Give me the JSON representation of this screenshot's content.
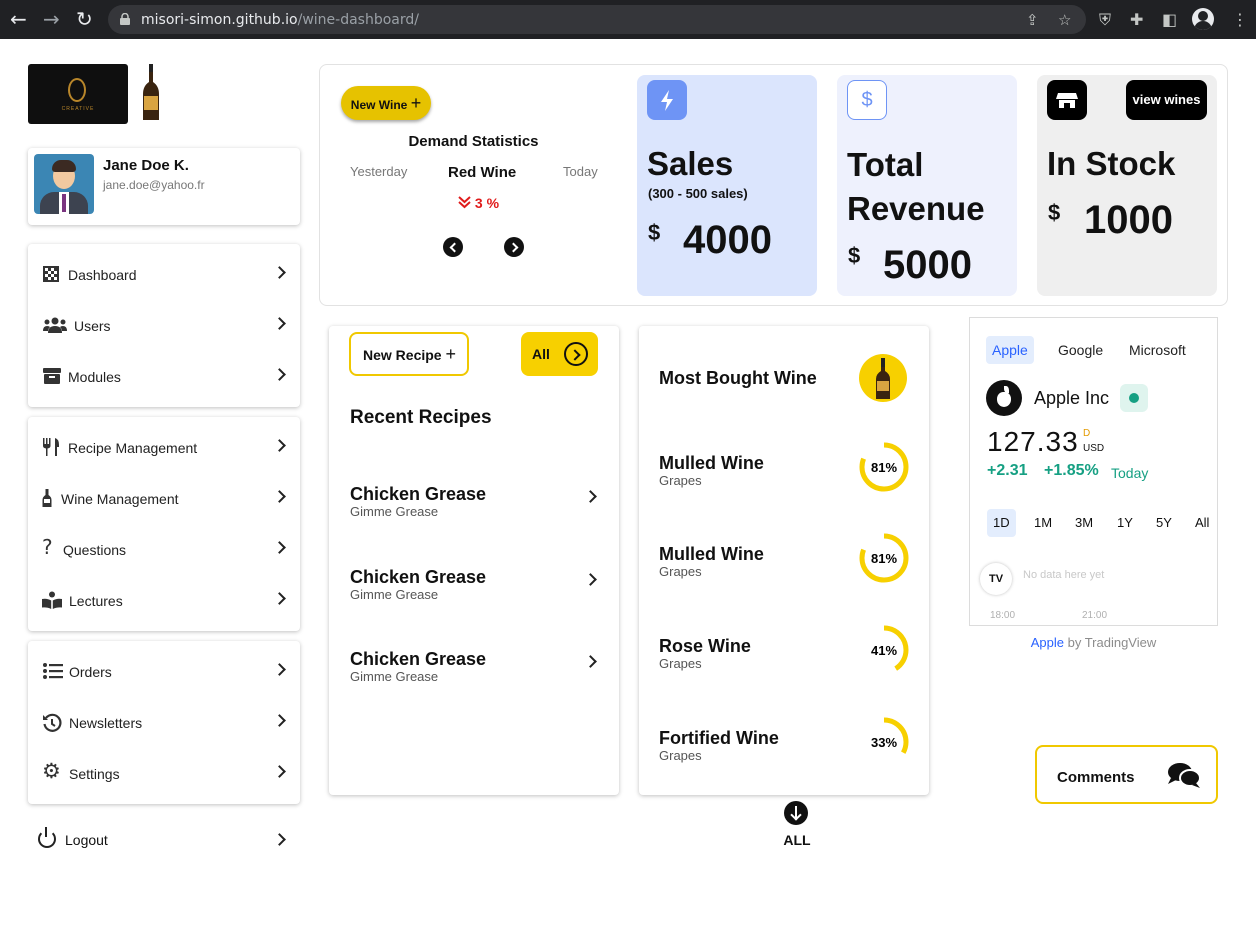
{
  "browser": {
    "url_domain": "misori-simon.github.io",
    "url_path": "/wine-dashboard/"
  },
  "profile": {
    "name": "Jane Doe K.",
    "email": "jane.doe@yahoo.fr"
  },
  "sidebar": {
    "group1": [
      {
        "label": "Dashboard",
        "icon": "checker-icon"
      },
      {
        "label": "Users",
        "icon": "users-icon"
      },
      {
        "label": "Modules",
        "icon": "box-icon"
      }
    ],
    "group2": [
      {
        "label": "Recipe Management",
        "icon": "utensils-icon"
      },
      {
        "label": "Wine Management",
        "icon": "bottle-icon"
      },
      {
        "label": "Questions",
        "icon": "question-icon"
      },
      {
        "label": "Lectures",
        "icon": "reader-icon"
      }
    ],
    "group3": [
      {
        "label": "Orders",
        "icon": "list-icon"
      },
      {
        "label": "Newsletters",
        "icon": "history-icon"
      },
      {
        "label": "Settings",
        "icon": "gear-icon"
      }
    ],
    "logout": "Logout"
  },
  "demand": {
    "new_wine": "New Wine",
    "title": "Demand Statistics",
    "left": "Yesterday",
    "center": "Red Wine",
    "right": "Today",
    "change": "3 %"
  },
  "stats": {
    "sales": {
      "title": "Sales",
      "subtitle": "(300 - 500 sales)",
      "currency": "$",
      "value": "4000"
    },
    "revenue": {
      "title_line1": "Total",
      "title_line2": "Revenue",
      "currency": "$",
      "value": "5000"
    },
    "stock": {
      "title": "In Stock",
      "currency": "$",
      "value": "1000",
      "button": "view wines"
    }
  },
  "recipes": {
    "new_button": "New Recipe",
    "all_button": "All",
    "title": "Recent Recipes",
    "items": [
      {
        "name": "Chicken Grease",
        "sub": "Gimme Grease"
      },
      {
        "name": "Chicken Grease",
        "sub": "Gimme Grease"
      },
      {
        "name": "Chicken Grease",
        "sub": "Gimme Grease"
      }
    ]
  },
  "wines": {
    "title": "Most Bought Wine",
    "items": [
      {
        "name": "Mulled Wine",
        "sub": "Grapes",
        "percent": 81,
        "label": "81%"
      },
      {
        "name": "Mulled Wine",
        "sub": "Grapes",
        "percent": 81,
        "label": "81%"
      },
      {
        "name": "Rose Wine",
        "sub": "Grapes",
        "percent": 41,
        "label": "41%"
      },
      {
        "name": "Fortified Wine",
        "sub": "Grapes",
        "percent": 33,
        "label": "33%"
      }
    ],
    "all_label": "ALL"
  },
  "ticker": {
    "tabs": [
      "Apple",
      "Google",
      "Microsoft"
    ],
    "company": "Apple Inc",
    "price": "127.33",
    "price_flag": "D",
    "price_currency": "USD",
    "change": "+2.31",
    "change_pct": "+1.85%",
    "period": "Today",
    "ranges": [
      "1D",
      "1M",
      "3M",
      "1Y",
      "5Y",
      "All"
    ],
    "tv_mark": "TV",
    "no_data": "No data here yet",
    "times": [
      "18:00",
      "21:00"
    ],
    "attribution_link": "Apple",
    "attribution_rest": "by TradingView"
  },
  "comments": {
    "label": "Comments"
  },
  "colors": {
    "accent_yellow": "#f7d000",
    "positive_green": "#16a083",
    "negative_red": "#e01b1b"
  }
}
